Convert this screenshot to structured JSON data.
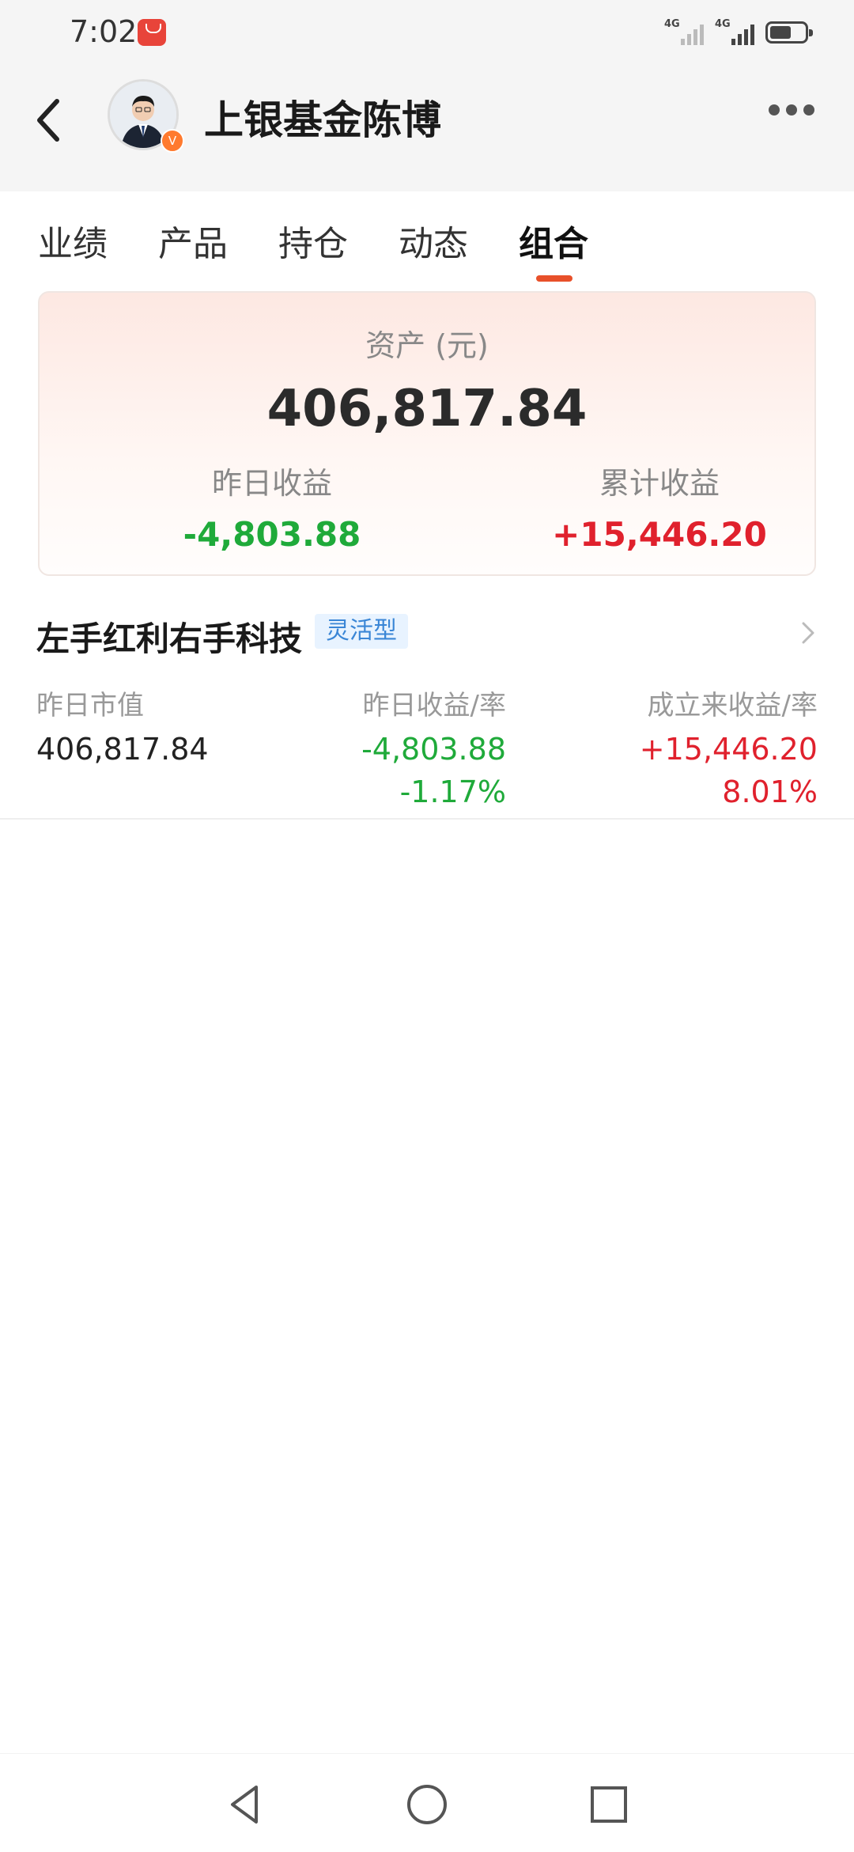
{
  "status_bar": {
    "time": "7:02",
    "signal1_label": "4G",
    "signal2_label": "4G",
    "app_icon": "huawei-store-icon"
  },
  "header": {
    "title": "上银基金陈博",
    "back_icon": "chevron-left-icon",
    "more_icon": "more-dots-icon",
    "verified_mark": "V"
  },
  "tabs": [
    {
      "label": "业绩",
      "active": false
    },
    {
      "label": "产品",
      "active": false
    },
    {
      "label": "持仓",
      "active": false
    },
    {
      "label": "动态",
      "active": false
    },
    {
      "label": "组合",
      "active": true
    }
  ],
  "asset_card": {
    "label": "资产 (元)",
    "value": "406,817.84",
    "yesterday_label": "昨日收益",
    "yesterday_value": "-4,803.88",
    "total_label": "累计收益",
    "total_value": "+15,446.20"
  },
  "portfolio": {
    "name": "左手红利右手科技",
    "tag": "灵活型",
    "col1_head": "昨日市值",
    "col1_value": "406,817.84",
    "col2_head": "昨日收益/率",
    "col2_value": "-4,803.88",
    "col2_rate": "-1.17%",
    "col3_head": "成立来收益/率",
    "col3_value": "+15,446.20",
    "col3_rate": "8.01%"
  },
  "colors": {
    "accent": "#e8502a",
    "positive": "#e0212d",
    "negative": "#1faa3a"
  }
}
